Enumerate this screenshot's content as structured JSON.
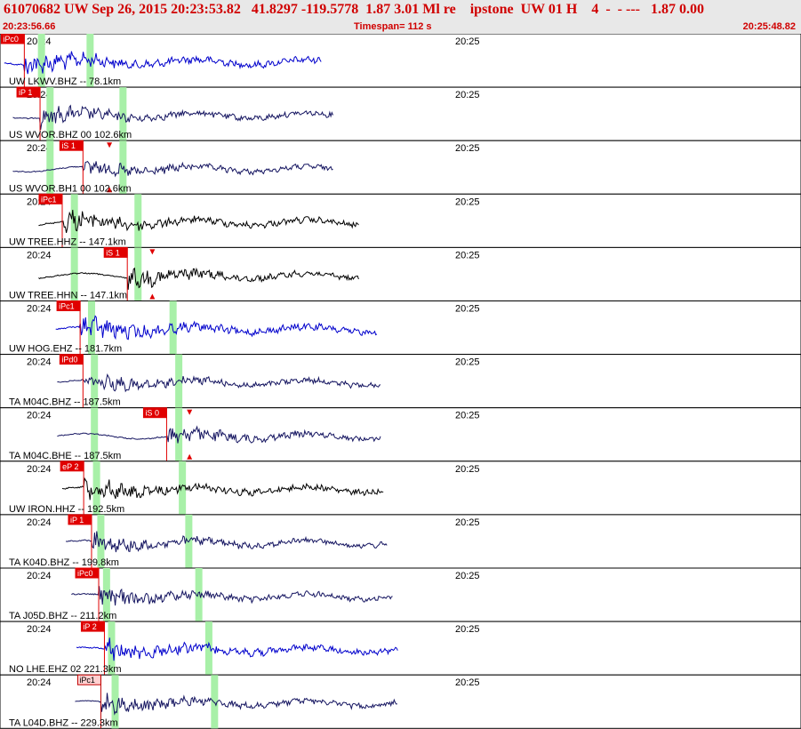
{
  "header": {
    "title": "61070682 UW Sep 26, 2015 20:23:53.82   41.8297 -119.5778  1.87 3.01 Ml re    ipstone  UW 01 H    4  -  - ---   1.87 0.00",
    "start_time": "20:23:56.66",
    "timespan": "Timespan= 112 s",
    "end_time": "20:25:48.82"
  },
  "colors": {
    "pick_red": "#e00000",
    "pick_pink": "#ffd0d0",
    "window_green": "#a8f0a8",
    "blue": "#0000cc",
    "navy": "#141460",
    "black": "#000000"
  },
  "minute_labels": [
    "20:24",
    "20:25"
  ],
  "traces": [
    {
      "label": "UW LKWV.BHZ -- 78.1km",
      "color": "blue",
      "amp": 0.55,
      "pick": "iPc0",
      "pick_t": 3.4,
      "style": "red",
      "windows": [
        5.8,
        12.6
      ],
      "s_pick": null,
      "s_t": null,
      "start": 0.6,
      "end": 45.0
    },
    {
      "label": "US WVOR.BHZ 00 102.6km",
      "color": "navy",
      "amp": 0.45,
      "pick": "iP 1",
      "pick_t": 5.6,
      "style": "red",
      "windows": [
        7.0,
        17.2
      ],
      "s_pick": null,
      "s_t": null,
      "start": 1.8,
      "end": 46.6
    },
    {
      "label": "US WVOR.BH1 00 102.6km",
      "color": "navy",
      "amp": 0.4,
      "pick": "iS 1",
      "pick_t": 11.6,
      "style": "red",
      "windows": [
        7.0,
        17.2
      ],
      "s_pick": "",
      "s_t": 15.3,
      "start": 1.8,
      "end": 46.6
    },
    {
      "label": "UW TREE.HHZ -- 147.1km",
      "color": "black",
      "amp": 0.5,
      "pick": "iPc1",
      "pick_t": 8.7,
      "style": "red",
      "windows": [
        10.4,
        19.3
      ],
      "s_pick": null,
      "s_t": null,
      "start": 5.4,
      "end": 50.2
    },
    {
      "label": "UW TREE.HHN -- 147.1km",
      "color": "black",
      "amp": 0.45,
      "pick": "iS 1",
      "pick_t": 17.8,
      "style": "red",
      "windows": [
        10.4,
        19.3
      ],
      "s_pick": "",
      "s_t": 21.3,
      "start": 5.4,
      "end": 50.2
    },
    {
      "label": "UW HOG.EHZ -- 181.7km",
      "color": "blue",
      "amp": 0.55,
      "pick": "iPc1",
      "pick_t": 11.2,
      "style": "red",
      "windows": [
        12.8,
        24.2
      ],
      "s_pick": null,
      "s_t": null,
      "start": 7.8,
      "end": 52.8
    },
    {
      "label": "TA M04C.BHZ -- 187.5km",
      "color": "navy",
      "amp": 0.45,
      "pick": "iPd0",
      "pick_t": 11.6,
      "style": "red",
      "windows": [
        13.2,
        25.0
      ],
      "s_pick": null,
      "s_t": null,
      "start": 8.0,
      "end": 53.2
    },
    {
      "label": "TA M04C.BHE -- 187.5km",
      "color": "navy",
      "amp": 0.4,
      "pick": "iS 0",
      "pick_t": 23.3,
      "style": "red",
      "windows": [
        13.2,
        25.0
      ],
      "s_pick": "",
      "s_t": 26.5,
      "start": 8.0,
      "end": 53.2
    },
    {
      "label": "UW IRON.HHZ -- 192.5km",
      "color": "black",
      "amp": 0.5,
      "pick": "eP 2",
      "pick_t": 11.7,
      "style": "red",
      "windows": [
        13.5,
        25.5
      ],
      "s_pick": null,
      "s_t": null,
      "start": 8.7,
      "end": 53.6
    },
    {
      "label": "TA K04D.BHZ -- 199.8km",
      "color": "navy",
      "amp": 0.45,
      "pick": "iP 1",
      "pick_t": 12.8,
      "style": "red",
      "windows": [
        14.1,
        26.4
      ],
      "s_pick": null,
      "s_t": null,
      "start": 9.2,
      "end": 54.2
    },
    {
      "label": "TA J05D.BHZ -- 211.2km",
      "color": "navy",
      "amp": 0.45,
      "pick": "iPc0",
      "pick_t": 13.8,
      "style": "red",
      "windows": [
        14.9,
        27.8
      ],
      "s_pick": null,
      "s_t": null,
      "start": 10.0,
      "end": 55.0
    },
    {
      "label": "NO LHE.EHZ 02 221.3km",
      "color": "blue",
      "amp": 0.5,
      "pick": "iP 2",
      "pick_t": 14.6,
      "style": "red",
      "windows": [
        15.6,
        29.2
      ],
      "s_pick": null,
      "s_t": null,
      "start": 10.7,
      "end": 55.6
    },
    {
      "label": "TA L04D.BHZ -- 229.3km",
      "color": "navy",
      "amp": 0.45,
      "pick": "iPc1",
      "pick_t": 14.1,
      "style": "pink",
      "windows": [
        16.1,
        30.0
      ],
      "s_pick": null,
      "s_t": null,
      "start": 10.5,
      "end": 55.6
    }
  ]
}
